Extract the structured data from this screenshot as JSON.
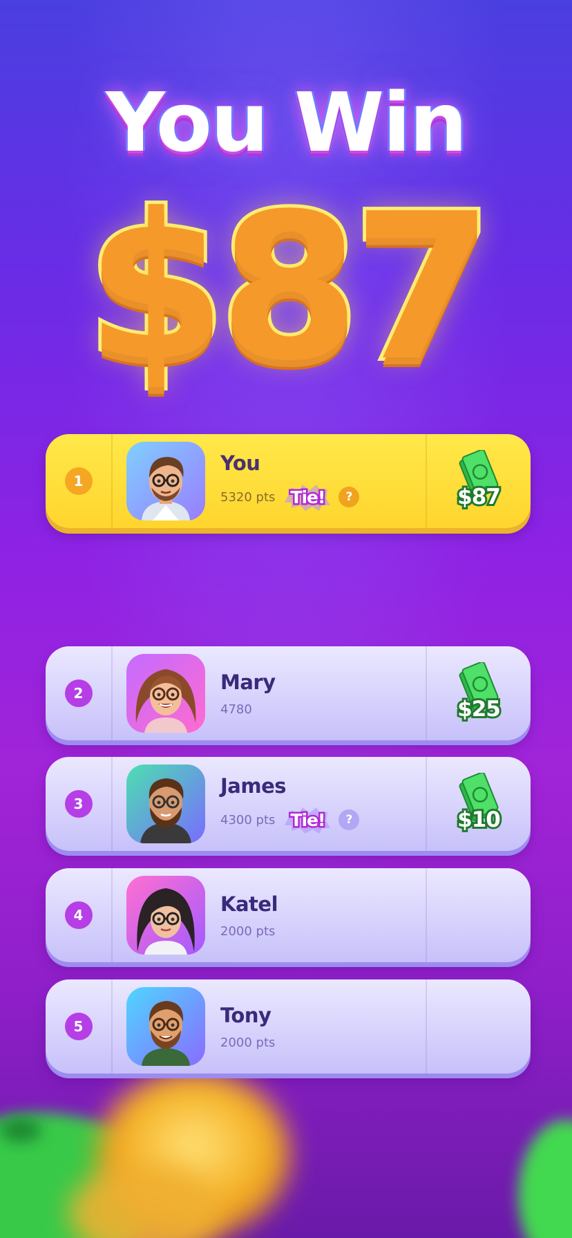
{
  "header": {
    "title": "You Win",
    "amount": "$87"
  },
  "leaderboard": [
    {
      "rank": "1",
      "name": "You",
      "score": "5320 pts",
      "tie": "Tie!",
      "help": "?",
      "prize": "$87",
      "highlight": true,
      "avatar": "man-with-glasses-avatar"
    },
    {
      "rank": "2",
      "name": "Mary",
      "score": "4780",
      "prize": "$25",
      "avatar": "woman-with-glasses-avatar"
    },
    {
      "rank": "3",
      "name": "James",
      "score": "4300 pts",
      "tie": "Tie!",
      "help": "?",
      "prize": "$10",
      "avatar": "bearded-man-avatar"
    },
    {
      "rank": "4",
      "name": "Katel",
      "score": "2000 pts",
      "avatar": "dark-haired-woman-avatar"
    },
    {
      "rank": "5",
      "name": "Tony",
      "score": "2000 pts",
      "avatar": "man-with-beard-avatar"
    }
  ],
  "icons": {
    "prize": "cash-stack-icon",
    "help": "question-icon",
    "tie": "tie-burst-badge"
  },
  "colors": {
    "highlight_row": "#ffd52e",
    "row": "#dcd7fd",
    "rank_badge": "#b63ee6",
    "money_green": "#3bd14f"
  }
}
